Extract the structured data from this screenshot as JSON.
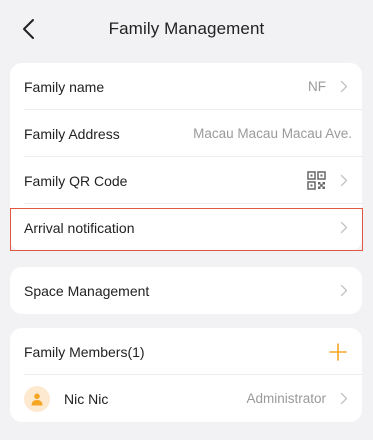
{
  "header": {
    "title": "Family Management"
  },
  "family_card": {
    "rows": [
      {
        "label": "Family name",
        "value": "NF"
      },
      {
        "label": "Family Address",
        "value": "Macau Macau Macau Ave."
      },
      {
        "label": "Family QR Code",
        "icon": "qr-code-icon"
      },
      {
        "label": "Arrival notification"
      }
    ]
  },
  "space_card": {
    "label": "Space Management"
  },
  "members_card": {
    "title": "Family Members(1)",
    "add_icon": "plus-icon",
    "members": [
      {
        "name": "Nic  Nic",
        "role": "Administrator",
        "avatar_icon": "person-icon"
      }
    ]
  },
  "colors": {
    "accent": "#f5a623",
    "highlight": "#e2553f",
    "background": "#f2f2f4",
    "muted_text": "#9a9a9a"
  }
}
